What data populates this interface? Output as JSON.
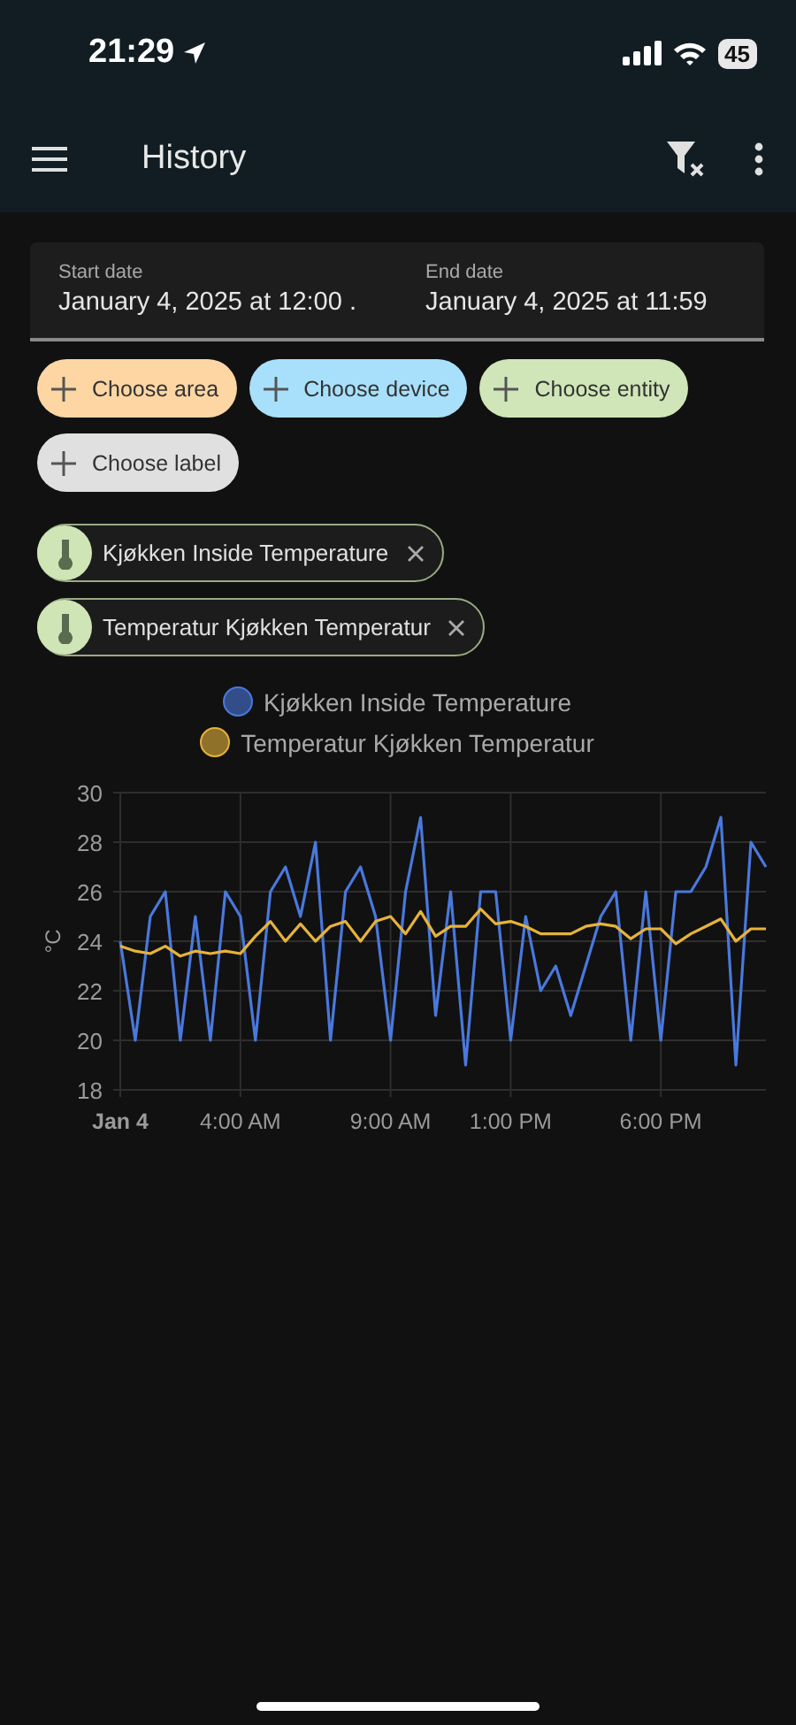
{
  "status_bar": {
    "time": "21:29",
    "battery": "45"
  },
  "app_bar": {
    "title": "History"
  },
  "date_range": {
    "start": {
      "label": "Start date",
      "value": "January 4, 2025 at 12:00 ."
    },
    "end": {
      "label": "End date",
      "value": "January 4, 2025 at 11:59"
    }
  },
  "target_pickers": [
    {
      "label": "Choose area",
      "color": "#fed6a4"
    },
    {
      "label": "Choose device",
      "color": "#a8e0fb"
    },
    {
      "label": "Choose entity",
      "color": "#d0e6b8"
    },
    {
      "label": "Choose label",
      "color": "#e0e0e0"
    }
  ],
  "selected_entities": [
    {
      "label": "Kjøkken Inside Temperature"
    },
    {
      "label": "Temperatur Kjøkken Temperatur"
    }
  ],
  "chart": {
    "chart_data": {
      "type": "line",
      "grid": true,
      "ylabel": "°C",
      "xlim": [
        0,
        21.5
      ],
      "ylim": [
        18,
        30
      ],
      "xticks": [
        {
          "value": 0,
          "label": "Jan 4"
        },
        {
          "value": 4,
          "label": "4:00 AM"
        },
        {
          "value": 9,
          "label": "9:00 AM"
        },
        {
          "value": 13,
          "label": "1:00 PM"
        },
        {
          "value": 18,
          "label": "6:00 PM"
        }
      ],
      "yticks": [
        18,
        20,
        22,
        24,
        26,
        28,
        30
      ],
      "x": [
        0,
        0.5,
        1,
        1.5,
        2,
        2.5,
        3,
        3.5,
        4,
        4.5,
        5,
        5.5,
        6,
        6.5,
        7,
        7.5,
        8,
        8.5,
        9,
        9.5,
        10,
        10.5,
        11,
        11.5,
        12,
        12.5,
        13,
        13.5,
        14,
        14.5,
        15,
        15.5,
        16,
        16.5,
        17,
        17.5,
        18,
        18.5,
        19,
        19.5,
        20,
        20.5,
        21,
        21.5
      ],
      "series": [
        {
          "name": "Kjøkken Inside Temperature",
          "color": "#4a78dc",
          "values": [
            24,
            20,
            25,
            26,
            20,
            25,
            20,
            26,
            25,
            20,
            26,
            27,
            25,
            28,
            20,
            26,
            27,
            25,
            20,
            26,
            29,
            21,
            26,
            19,
            26,
            26,
            20,
            25,
            22,
            23,
            21,
            23,
            25,
            26,
            20,
            26,
            20,
            26,
            26,
            27,
            29,
            19,
            28,
            27
          ]
        },
        {
          "name": "Temperatur Kjøkken Temperatur",
          "color": "#e6b33a",
          "values": [
            23.8,
            23.6,
            23.5,
            23.8,
            23.4,
            23.6,
            23.5,
            23.6,
            23.5,
            24.2,
            24.8,
            24.0,
            24.7,
            24.0,
            24.6,
            24.8,
            24.0,
            24.8,
            25.0,
            24.3,
            25.2,
            24.2,
            24.6,
            24.6,
            25.3,
            24.7,
            24.8,
            24.6,
            24.3,
            24.3,
            24.3,
            24.6,
            24.7,
            24.6,
            24.1,
            24.5,
            24.5,
            23.9,
            24.3,
            24.6,
            24.9,
            24.0,
            24.5,
            24.5
          ]
        }
      ]
    }
  }
}
